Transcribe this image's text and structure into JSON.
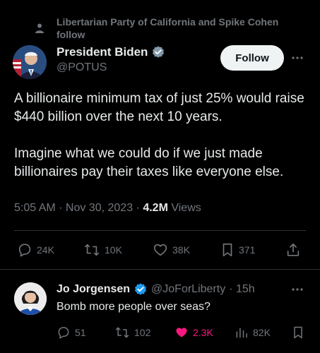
{
  "social_context": {
    "text": "Libertarian Party of California and Spike Cohen follow",
    "icon": "person-icon"
  },
  "tweet": {
    "author_name": "President Biden",
    "author_handle": "@POTUS",
    "follow_label": "Follow",
    "body": [
      "A billionaire minimum tax of just 25% would raise $440 billion over the next 10 years.",
      "Imagine what we could do if we just made billionaires pay their taxes like everyone else."
    ],
    "timestamp": "5:05 AM · Nov 30, 2023 · ",
    "views_count": "4.2M",
    "views_label": " Views",
    "stats": {
      "replies": "24K",
      "reposts": "10K",
      "likes": "38K",
      "bookmarks": "371"
    }
  },
  "reply": {
    "author_name": "Jo Jorgensen",
    "author_handle": "@JoForLiberty",
    "time": "· 15h",
    "body": "Bomb more people over seas?",
    "stats": {
      "replies": "51",
      "reposts": "102",
      "likes": "2.3K",
      "views": "82K"
    }
  },
  "colors": {
    "background": "#000000",
    "text": "#e7e9ea",
    "muted": "#71767b",
    "verified": "#1d9bf0",
    "liked": "#f91880",
    "divider": "#2f3336"
  }
}
